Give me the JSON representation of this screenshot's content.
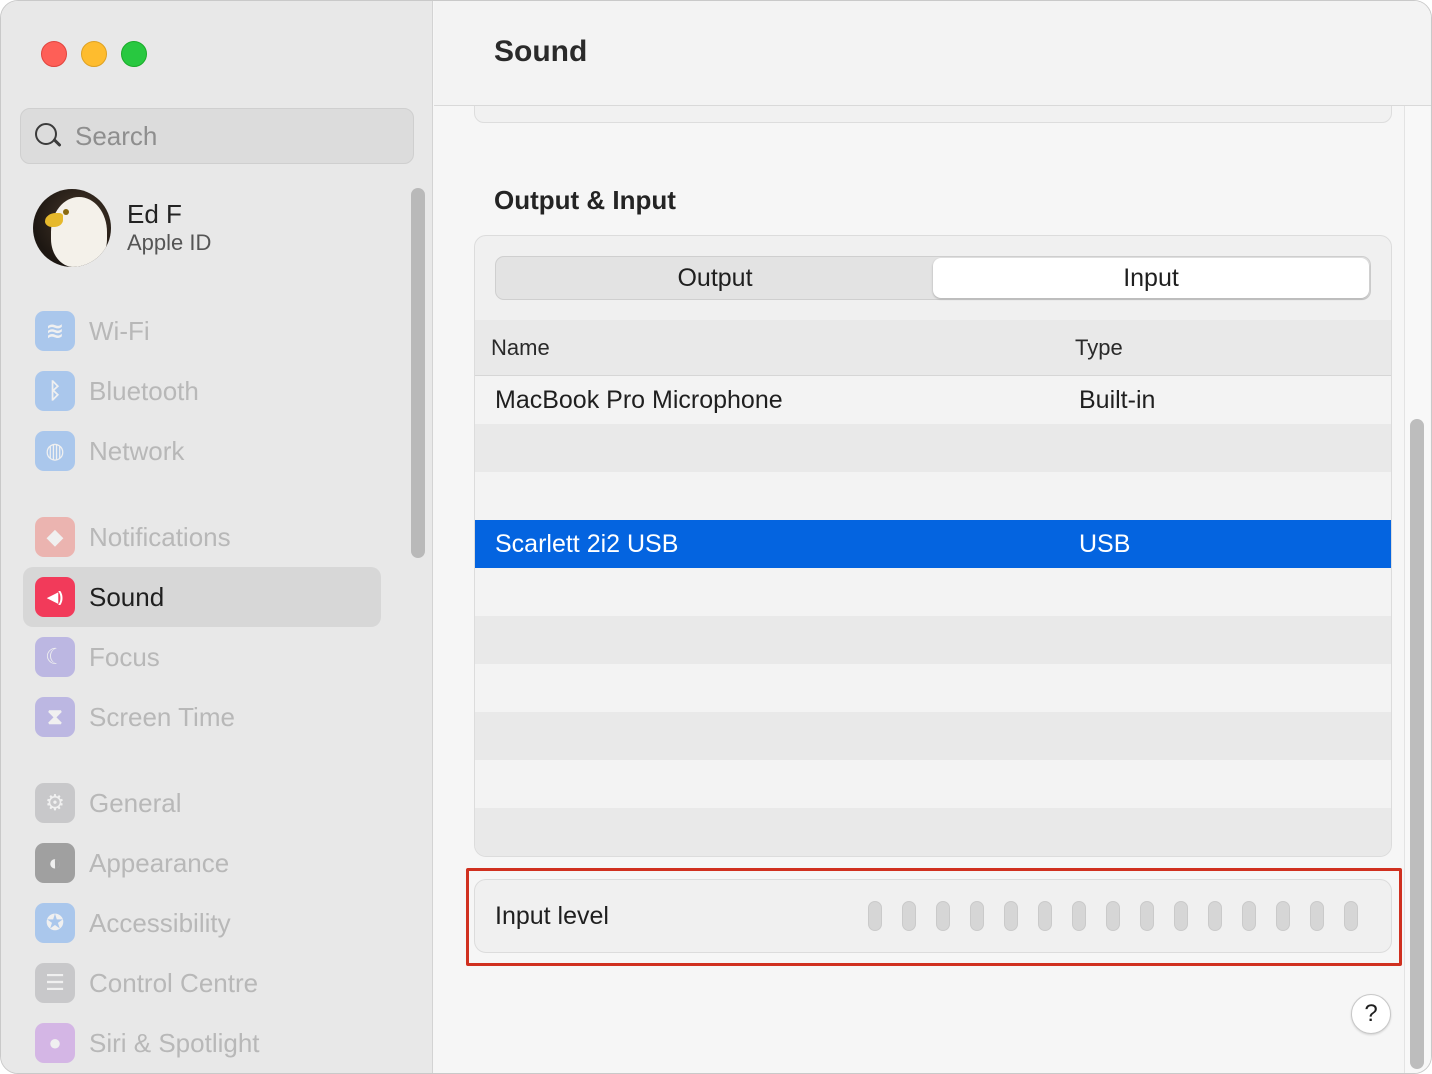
{
  "window": {
    "title": "Sound"
  },
  "sidebar": {
    "search": {
      "placeholder": "Search",
      "value": ""
    },
    "profile": {
      "name": "Ed F",
      "subtitle": "Apple ID"
    },
    "items": [
      {
        "label": "Wi-Fi",
        "icon": "wifi-icon",
        "color": "#3a8cf6",
        "glyph": "≋"
      },
      {
        "label": "Bluetooth",
        "icon": "bluetooth-icon",
        "color": "#3a8cf6",
        "glyph": "ᛒ"
      },
      {
        "label": "Network",
        "icon": "globe-icon",
        "color": "#3a8cf6",
        "glyph": "◍"
      },
      {
        "label": "Notifications",
        "icon": "bell-icon",
        "color": "#f2564b",
        "glyph": "◆"
      },
      {
        "label": "Sound",
        "icon": "speaker-icon",
        "color": "#f23a5a",
        "glyph": "◀)"
      },
      {
        "label": "Focus",
        "icon": "moon-icon",
        "color": "#6b5fd8",
        "glyph": "☾"
      },
      {
        "label": "Screen Time",
        "icon": "hourglass-icon",
        "color": "#6b5fd8",
        "glyph": "⧗"
      },
      {
        "label": "General",
        "icon": "gear-icon",
        "color": "#8e8e93",
        "glyph": "⚙"
      },
      {
        "label": "Appearance",
        "icon": "appearance-icon",
        "color": "#1c1c1e",
        "glyph": "◐"
      },
      {
        "label": "Accessibility",
        "icon": "accessibility-icon",
        "color": "#3a8cf6",
        "glyph": "✪"
      },
      {
        "label": "Control Centre",
        "icon": "toggles-icon",
        "color": "#8e8e93",
        "glyph": "☰"
      },
      {
        "label": "Siri & Spotlight",
        "icon": "siri-icon",
        "color": "#b05be0",
        "glyph": "●"
      }
    ],
    "selected_label": "Sound"
  },
  "main": {
    "section_title": "Output & Input",
    "tabs": [
      {
        "label": "Output",
        "active": false
      },
      {
        "label": "Input",
        "active": true
      }
    ],
    "table": {
      "headers": {
        "name": "Name",
        "type": "Type"
      },
      "rows": [
        {
          "name": "MacBook Pro Microphone",
          "type": "Built-in",
          "selected": false
        },
        {
          "name": "",
          "type": "",
          "selected": false
        },
        {
          "name": "",
          "type": "",
          "selected": false
        },
        {
          "name": "Scarlett 2i2 USB",
          "type": "USB",
          "selected": true
        },
        {
          "name": "",
          "type": "",
          "selected": false
        },
        {
          "name": "",
          "type": "",
          "selected": false
        },
        {
          "name": "",
          "type": "",
          "selected": false
        },
        {
          "name": "",
          "type": "",
          "selected": false
        },
        {
          "name": "",
          "type": "",
          "selected": false
        },
        {
          "name": "",
          "type": "",
          "selected": false
        }
      ]
    },
    "input_level": {
      "label": "Input level",
      "segments": 15,
      "active_segments": 0
    },
    "help_label": "?"
  },
  "colors": {
    "accent": "#0464e0",
    "highlight_box": "#d0301f"
  }
}
